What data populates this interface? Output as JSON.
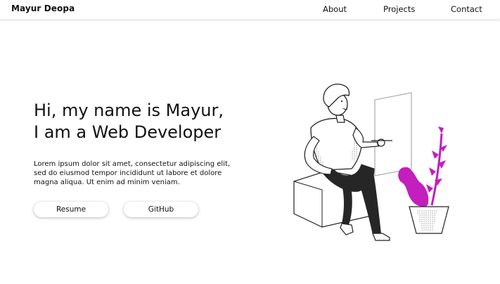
{
  "navbar": {
    "brand": "Mayur Deopa",
    "links": [
      "About",
      "Projects",
      "Contact"
    ]
  },
  "hero": {
    "title_lines": [
      "Hi, my name is Mayur,",
      "I am a Web Developer"
    ],
    "text_lines": [
      "Lorem ipsum dolor sit amet, consectetur adipiscing elit,",
      "sed do eiusmod tempor incididunt ut labore et dolore",
      "magna aliqua. Ut enim ad minim veniam."
    ],
    "buttons": [
      "Resume",
      "GitHub"
    ]
  },
  "colors": {
    "accent": "#c21fbd",
    "line": "#222222",
    "background": "#ffffff"
  },
  "icons": {
    "illustration": "developer-at-virtual-screen-illustration"
  }
}
